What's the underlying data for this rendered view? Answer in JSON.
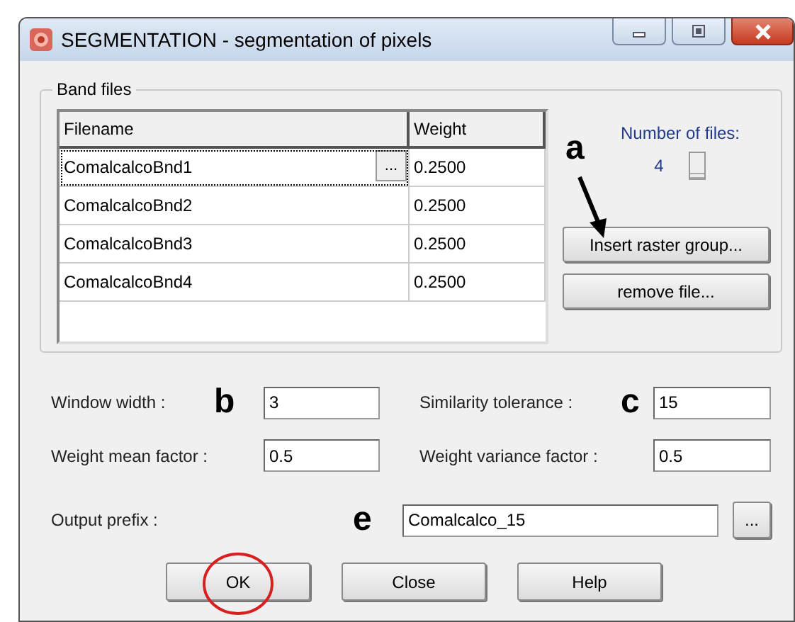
{
  "window": {
    "title": "SEGMENTATION - segmentation of pixels"
  },
  "band_files": {
    "legend": "Band files",
    "table": {
      "columns": [
        "Filename",
        "Weight"
      ],
      "cell_button": "...",
      "rows": [
        {
          "filename": "ComalcalcoBnd1",
          "weight": "0.2500",
          "selected": true
        },
        {
          "filename": "ComalcalcoBnd2",
          "weight": "0.2500",
          "selected": false
        },
        {
          "filename": "ComalcalcoBnd3",
          "weight": "0.2500",
          "selected": false
        },
        {
          "filename": "ComalcalcoBnd4",
          "weight": "0.2500",
          "selected": false
        }
      ]
    },
    "number_of_files": {
      "label": "Number of files:",
      "value": "4"
    },
    "annotation": "a",
    "buttons": [
      "Insert raster group...",
      "remove file..."
    ]
  },
  "parameters": [
    {
      "label": "Window width :",
      "annotation": "b",
      "value": "3"
    },
    {
      "label": "Similarity tolerance :",
      "annotation": "c",
      "value": "15"
    },
    {
      "label": "Weight mean factor :",
      "value": "0.5"
    },
    {
      "label": "Weight variance factor :",
      "value": "0.5"
    }
  ],
  "output_prefix": {
    "label": "Output prefix :",
    "annotation": "e",
    "value": "Comalcalco_15",
    "browse": "..."
  },
  "buttons": [
    {
      "label": "OK",
      "circled": true
    },
    {
      "label": "Close",
      "circled": false
    },
    {
      "label": "Help",
      "circled": false
    }
  ]
}
